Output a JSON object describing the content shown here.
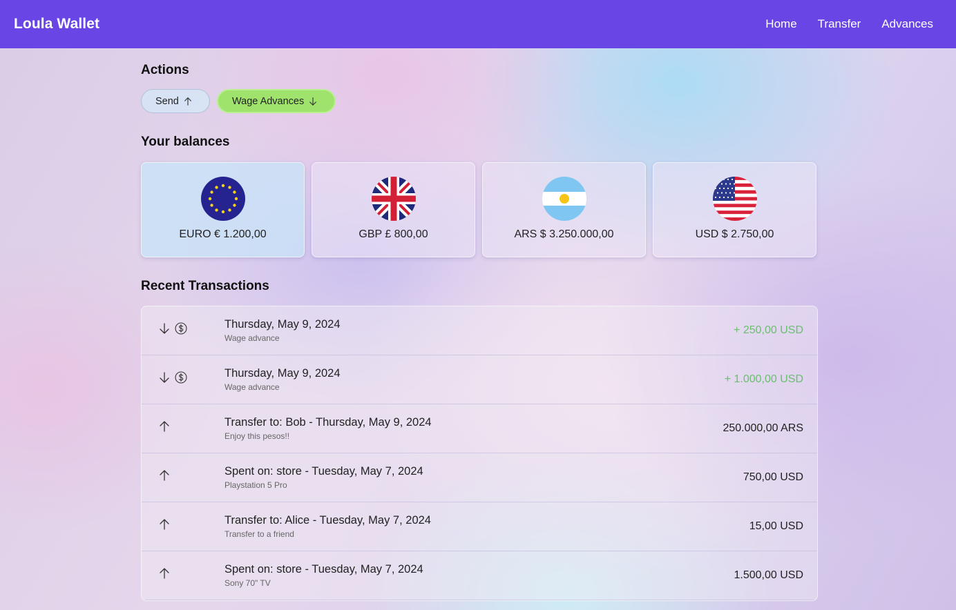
{
  "app": {
    "brand": "Loula Wallet",
    "nav": [
      {
        "label": "Home"
      },
      {
        "label": "Transfer"
      },
      {
        "label": "Advances"
      }
    ],
    "accent_color": "#6a45e6"
  },
  "actions": {
    "title": "Actions",
    "send_label": "Send",
    "wage_label": "Wage Advances",
    "wage_color": "#9fe36c"
  },
  "balances": {
    "title": "Your balances",
    "items": [
      {
        "label": "EURO € 1.200,00",
        "flag": "eu-flag-icon"
      },
      {
        "label": "GBP £ 800,00",
        "flag": "uk-flag-icon"
      },
      {
        "label": "ARS $ 3.250.000,00",
        "flag": "argentina-flag-icon"
      },
      {
        "label": "USD $ 2.750,00",
        "flag": "usa-flag-icon"
      }
    ]
  },
  "transactions": {
    "title": "Recent Transactions",
    "positive_color": "#6abf6e",
    "items": [
      {
        "direction": "in",
        "heading": "Thursday, May 9, 2024",
        "note": "Wage advance",
        "amount": "+ 250,00 USD",
        "positive": true
      },
      {
        "direction": "in",
        "heading": "Thursday, May 9, 2024",
        "note": "Wage advance",
        "amount": "+ 1.000,00 USD",
        "positive": true
      },
      {
        "direction": "out",
        "heading": "Transfer to: Bob - Thursday, May 9, 2024",
        "note": "Enjoy this pesos!!",
        "amount": "250.000,00 ARS",
        "positive": false
      },
      {
        "direction": "out",
        "heading": "Spent on: store - Tuesday, May 7, 2024",
        "note": "Playstation 5 Pro",
        "amount": "750,00 USD",
        "positive": false
      },
      {
        "direction": "out",
        "heading": "Transfer to: Alice - Tuesday, May 7, 2024",
        "note": "Transfer to a friend",
        "amount": "15,00 USD",
        "positive": false
      },
      {
        "direction": "out",
        "heading": "Spent on: store - Tuesday, May 7, 2024",
        "note": "Sony 70\" TV",
        "amount": "1.500,00 USD",
        "positive": false
      }
    ]
  }
}
